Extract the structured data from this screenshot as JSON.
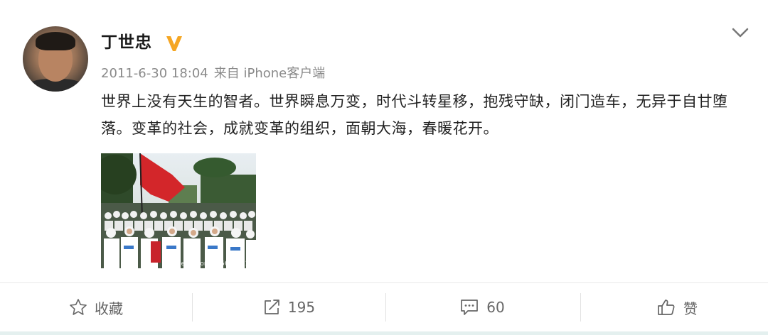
{
  "post": {
    "author": "丁世忠",
    "timestamp": "2011-6-30 18:04",
    "source": "来自 iPhone客户端",
    "text": "世界上没有天生的智者。世界瞬息万变，时代斗转星移，抱残守缺，闭门造车，无异于自甘堕落。变革的社会，成就变革的组织，面朝大海，春暖花开。",
    "image_watermark": "weibo.com/1956578313"
  },
  "actions": {
    "favorite_label": "收藏",
    "repost_count": "195",
    "comment_count": "60",
    "like_label": "赞"
  },
  "icons": {
    "verified": "verified-v-icon",
    "menu": "chevron-down-icon",
    "favorite": "star-icon",
    "repost": "share-icon",
    "comment": "comment-icon",
    "like": "thumbs-up-icon"
  },
  "colors": {
    "verified_badge": "#f5a623",
    "text": "#222222",
    "meta": "#8a8a8a"
  }
}
